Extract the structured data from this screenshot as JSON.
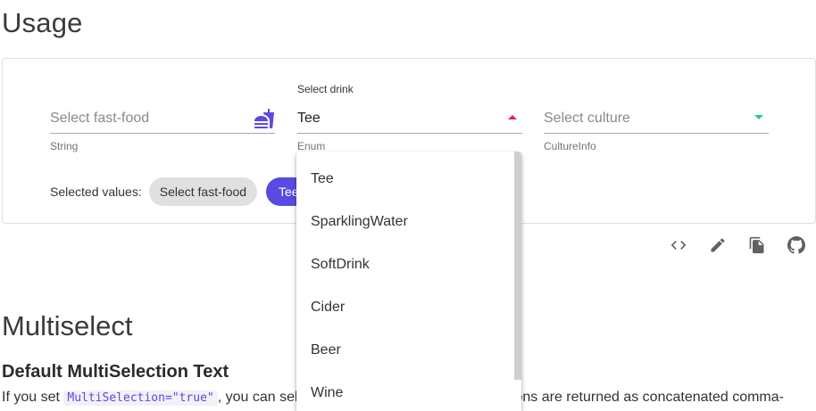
{
  "headings": {
    "usage": "Usage",
    "multiselect": "Multiselect",
    "default_text": "Default MultiSelection Text"
  },
  "fastfood": {
    "placeholder": "Select fast-food",
    "helper": "String",
    "icon": "fastfood-icon"
  },
  "drink": {
    "label": "Select drink",
    "value": "Tee",
    "helper": "Enum",
    "arrow_color": "#e91e63"
  },
  "culture": {
    "placeholder": "Select culture",
    "helper": "CultureInfo",
    "arrow_color": "#26c6a0"
  },
  "selected": {
    "label": "Selected values:",
    "chips": [
      "Select fast-food",
      "Tee"
    ]
  },
  "dropdown": {
    "options": [
      "Tee",
      "SparklingWater",
      "SoftDrink",
      "Cider",
      "Beer",
      "Wine"
    ]
  },
  "toolbar": {
    "icons": [
      "code-icon",
      "edit-icon",
      "copy-icon",
      "github-icon"
    ]
  },
  "paragraph": {
    "start": "If you set ",
    "code": "MultiSelection=\"true\"",
    "mid": ", you can sel",
    "end": "ptions are returned as concatenated comma-"
  },
  "colors": {
    "primary": "#594ae2",
    "secondary": "#e91e63",
    "tertiary": "#26c6a0"
  }
}
